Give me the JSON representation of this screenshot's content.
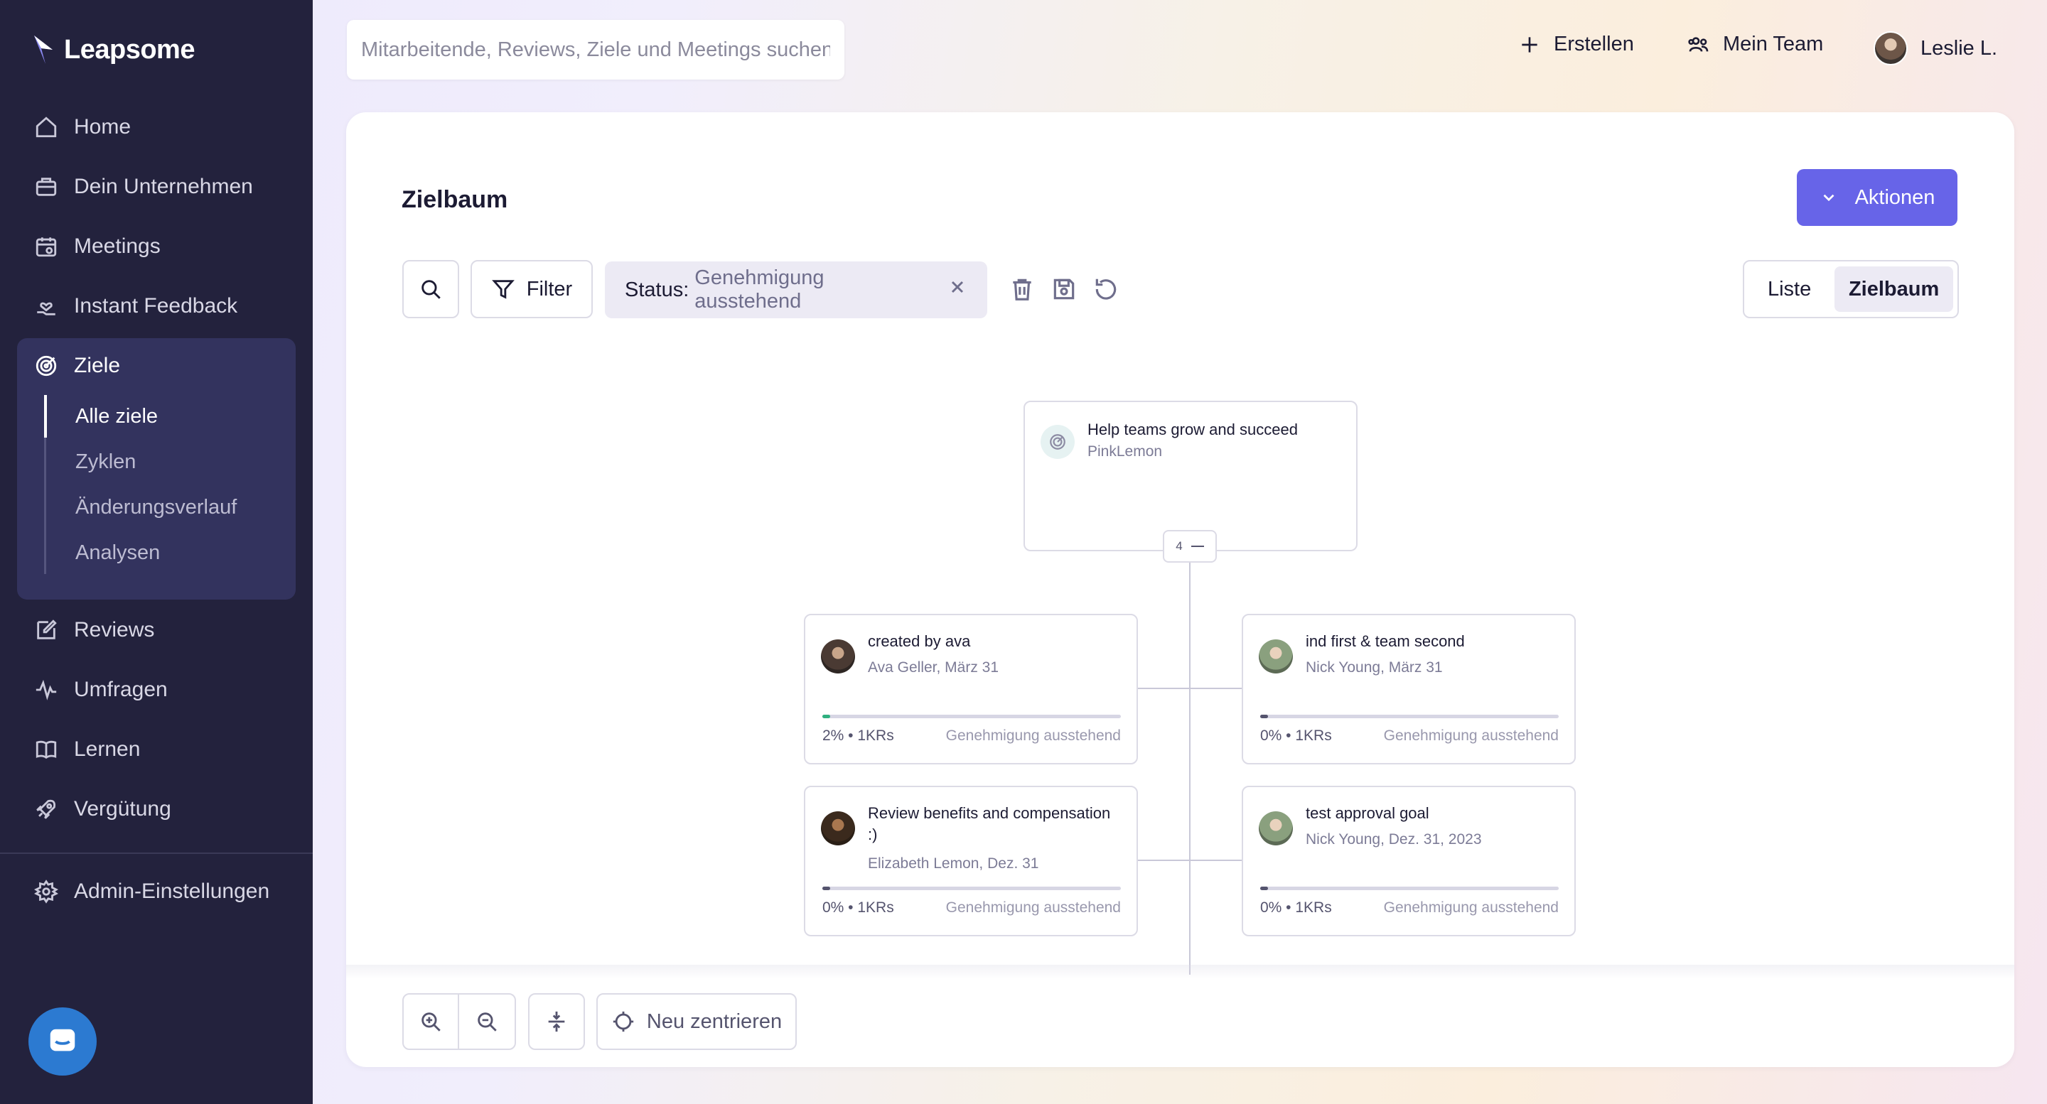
{
  "app": {
    "name": "Leapsome"
  },
  "sidebar": {
    "items": [
      {
        "label": "Home",
        "icon": "home-icon"
      },
      {
        "label": "Dein Unternehmen",
        "icon": "briefcase-icon"
      },
      {
        "label": "Meetings",
        "icon": "calendar-icon"
      },
      {
        "label": "Instant Feedback",
        "icon": "hand-heart-icon"
      },
      {
        "label": "Ziele",
        "icon": "target-icon"
      },
      {
        "label": "Reviews",
        "icon": "edit-icon"
      },
      {
        "label": "Umfragen",
        "icon": "pulse-icon"
      },
      {
        "label": "Lernen",
        "icon": "book-icon"
      },
      {
        "label": "Vergütung",
        "icon": "rocket-icon"
      },
      {
        "label": "Admin-Einstellungen",
        "icon": "gear-icon"
      }
    ],
    "goals_sub": [
      "Alle ziele",
      "Zyklen",
      "Änderungsverlauf",
      "Analysen"
    ],
    "active_sub": "Alle ziele"
  },
  "topbar": {
    "search_placeholder": "Mitarbeitende, Reviews, Ziele und Meetings suchen",
    "create_label": "Erstellen",
    "team_label": "Mein Team",
    "user_label": "Leslie L."
  },
  "page": {
    "title": "Zielbaum",
    "actions_label": "Aktionen",
    "filter_label": "Filter",
    "status_key": "Status:",
    "status_value": "Genehmigung ausstehend",
    "view_list": "Liste",
    "view_tree": "Zielbaum",
    "recenter_label": "Neu zentrieren"
  },
  "tree": {
    "root": {
      "title": "Help teams grow and succeed",
      "owner": "PinkLemon",
      "children_count": "4"
    },
    "children": [
      {
        "title": "created by ava",
        "owner": "Ava Geller, März 31",
        "progress_pct": 2,
        "meta": "2% • 1KRs",
        "status": "Genehmigung ausstehend",
        "accent": "#2fb07f"
      },
      {
        "title": "ind first & team second",
        "owner": "Nick Young, März 31",
        "progress_pct": 0,
        "meta": "0% • 1KRs",
        "status": "Genehmigung ausstehend",
        "accent": "#55546e"
      },
      {
        "title": "Review benefits and compensation :)",
        "owner": "Elizabeth Lemon, Dez. 31",
        "progress_pct": 0,
        "meta": "0% • 1KRs",
        "status": "Genehmigung ausstehend",
        "accent": "#55546e"
      },
      {
        "title": "test approval goal",
        "owner": "Nick Young, Dez. 31, 2023",
        "progress_pct": 0,
        "meta": "0% • 1KRs",
        "status": "Genehmigung ausstehend",
        "accent": "#55546e"
      }
    ]
  },
  "colors": {
    "sidebar_bg": "#23223d",
    "accent": "#6764e8",
    "chat": "#2c7ad1"
  }
}
